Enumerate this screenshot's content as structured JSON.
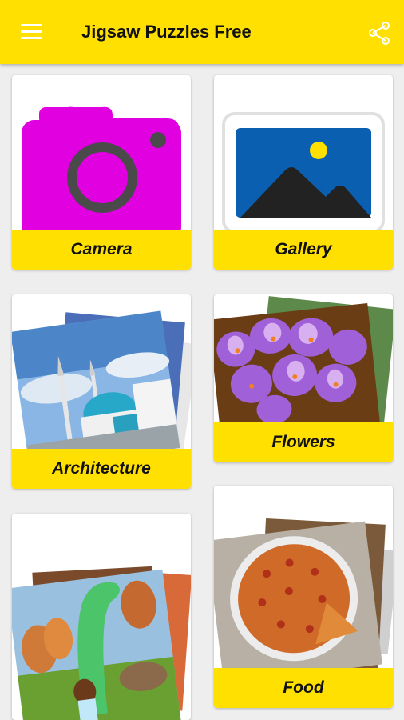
{
  "app": {
    "title": "Jigsaw Puzzles Free",
    "menu_icon": "hamburger-menu-icon",
    "share_icon": "share-icon"
  },
  "colors": {
    "accent": "#ffe000",
    "background": "#eeeeee",
    "camera_icon": "#e000e0",
    "gallery_blue": "#0a5fb0"
  },
  "categories": [
    {
      "label": "Camera"
    },
    {
      "label": "Gallery"
    },
    {
      "label": "Architecture"
    },
    {
      "label": "Flowers"
    },
    {
      "label": ""
    },
    {
      "label": "Food"
    }
  ]
}
